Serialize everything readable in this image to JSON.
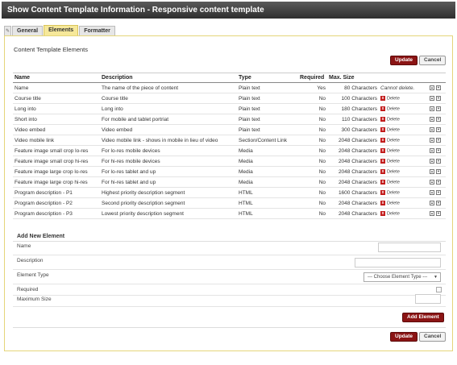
{
  "window": {
    "title": "Show Content Template Information - Responsive content template"
  },
  "tabs": [
    {
      "label": "General",
      "active": false
    },
    {
      "label": "Elements",
      "active": true
    },
    {
      "label": "Formatter",
      "active": false
    }
  ],
  "section_title": "Content Template Elements",
  "buttons": {
    "update": "Update",
    "cancel": "Cancel",
    "add_element": "Add Element",
    "delete": "Delete"
  },
  "table": {
    "headers": {
      "name": "Name",
      "description": "Description",
      "type": "Type",
      "required": "Required",
      "max_size": "Max. Size"
    },
    "rows": [
      {
        "name": "Name",
        "description": "The name of the piece of content",
        "type": "Plain text",
        "required": "Yes",
        "max_size": "80 Characters",
        "action": "Cannot delete."
      },
      {
        "name": "Course title",
        "description": "Course title",
        "type": "Plain text",
        "required": "No",
        "max_size": "100 Characters",
        "action": "Delete"
      },
      {
        "name": "Long into",
        "description": "Long into",
        "type": "Plain text",
        "required": "No",
        "max_size": "180 Characters",
        "action": "Delete"
      },
      {
        "name": "Short into",
        "description": "For mobile and tablet portriat",
        "type": "Plain text",
        "required": "No",
        "max_size": "110 Characters",
        "action": "Delete"
      },
      {
        "name": "Video embed",
        "description": "Video embed",
        "type": "Plain text",
        "required": "No",
        "max_size": "300 Characters",
        "action": "Delete"
      },
      {
        "name": "Video mobile link",
        "description": "Video mobile link - shows in mobile in lieu of video",
        "type": "Section/Content Link",
        "required": "No",
        "max_size": "2048 Characters",
        "action": "Delete"
      },
      {
        "name": "Feature image small crop lo-res",
        "description": "For lo-res mobile devices",
        "type": "Media",
        "required": "No",
        "max_size": "2048 Characters",
        "action": "Delete"
      },
      {
        "name": "Feature image small crop hi-res",
        "description": "For hi-res mobile devices",
        "type": "Media",
        "required": "No",
        "max_size": "2048 Characters",
        "action": "Delete"
      },
      {
        "name": "Feature image large crop lo-res",
        "description": "For lo-res tablet and up",
        "type": "Media",
        "required": "No",
        "max_size": "2048 Characters",
        "action": "Delete"
      },
      {
        "name": "Feature image large crop hi-res",
        "description": "For hi-res tablet and up",
        "type": "Media",
        "required": "No",
        "max_size": "2048 Characters",
        "action": "Delete"
      },
      {
        "name": "Program description - P1",
        "description": "Highest priority description segment",
        "type": "HTML",
        "required": "No",
        "max_size": "1600 Characters",
        "action": "Delete"
      },
      {
        "name": "Program description - P2",
        "description": "Second priority description segment",
        "type": "HTML",
        "required": "No",
        "max_size": "2048 Characters",
        "action": "Delete"
      },
      {
        "name": "Program description - P3",
        "description": "Lowest priority description segment",
        "type": "HTML",
        "required": "No",
        "max_size": "2048 Characters",
        "action": "Delete"
      }
    ]
  },
  "add_new": {
    "title": "Add New Element",
    "name_label": "Name",
    "description_label": "Description",
    "type_label": "Element Type",
    "type_placeholder": "--- Choose Element Type ---",
    "required_label": "Required",
    "max_size_label": "Maximum Size"
  },
  "colors": {
    "accent": "#8b1414",
    "active_tab": "#f6e89a",
    "titlebar": "#3a3a3a"
  }
}
